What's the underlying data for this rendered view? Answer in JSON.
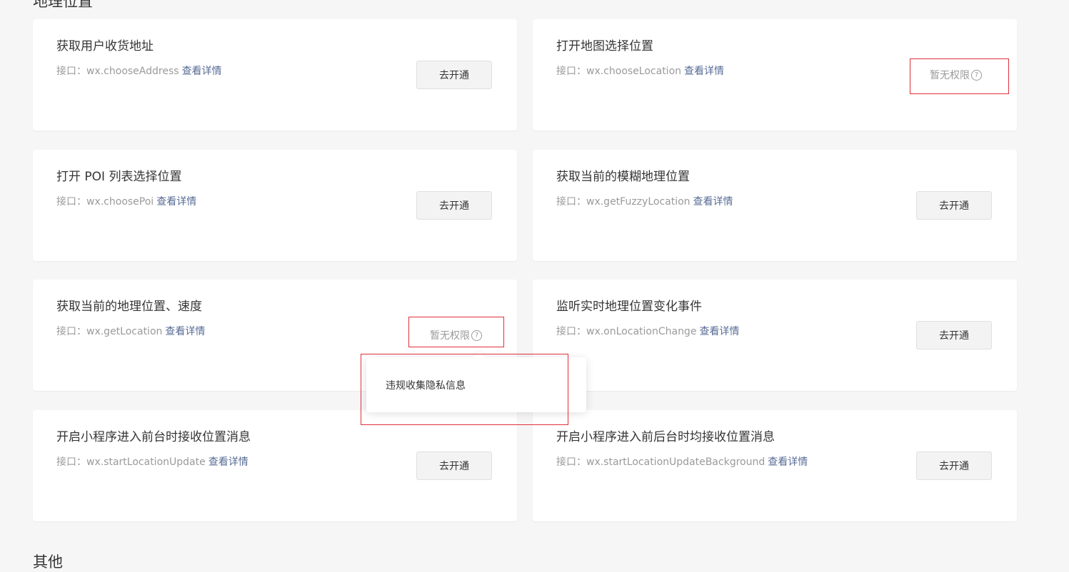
{
  "section": {
    "title": "地理位置"
  },
  "cards": [
    {
      "title": "获取用户收货地址",
      "api_prefix": "接口：wx.chooseAddress",
      "detail": "查看详情",
      "button": "去开通"
    },
    {
      "title": "打开地图选择位置",
      "api_prefix": "接口：wx.chooseLocation",
      "detail": "查看详情",
      "status": "暂无权限",
      "help_glyph": "?"
    },
    {
      "title": "打开 POI 列表选择位置",
      "api_prefix": "接口：wx.choosePoi",
      "detail": "查看详情",
      "button": "去开通"
    },
    {
      "title": "获取当前的模糊地理位置",
      "api_prefix": "接口：wx.getFuzzyLocation",
      "detail": "查看详情",
      "button": "去开通"
    },
    {
      "title": "获取当前的地理位置、速度",
      "api_prefix": "接口：wx.getLocation",
      "detail": "查看详情",
      "status": "暂无权限",
      "help_glyph": "?"
    },
    {
      "title": "监听实时地理位置变化事件",
      "api_prefix": "接口：wx.onLocationChange",
      "detail": "查看详情",
      "button": "去开通"
    },
    {
      "title": "开启小程序进入前台时接收位置消息",
      "api_prefix": "接口：wx.startLocationUpdate",
      "detail": "查看详情",
      "button": "去开通"
    },
    {
      "title": "开启小程序进入前后台时均接收位置消息",
      "api_prefix": "接口：wx.startLocationUpdateBackground",
      "detail": "查看详情",
      "button": "去开通"
    }
  ],
  "tooltip": {
    "text": "违规收集隐私信息"
  },
  "next_section": {
    "title": "其他"
  },
  "colors": {
    "link": "#576b95",
    "highlight": "#e0303a",
    "muted": "#9a9a9a"
  }
}
